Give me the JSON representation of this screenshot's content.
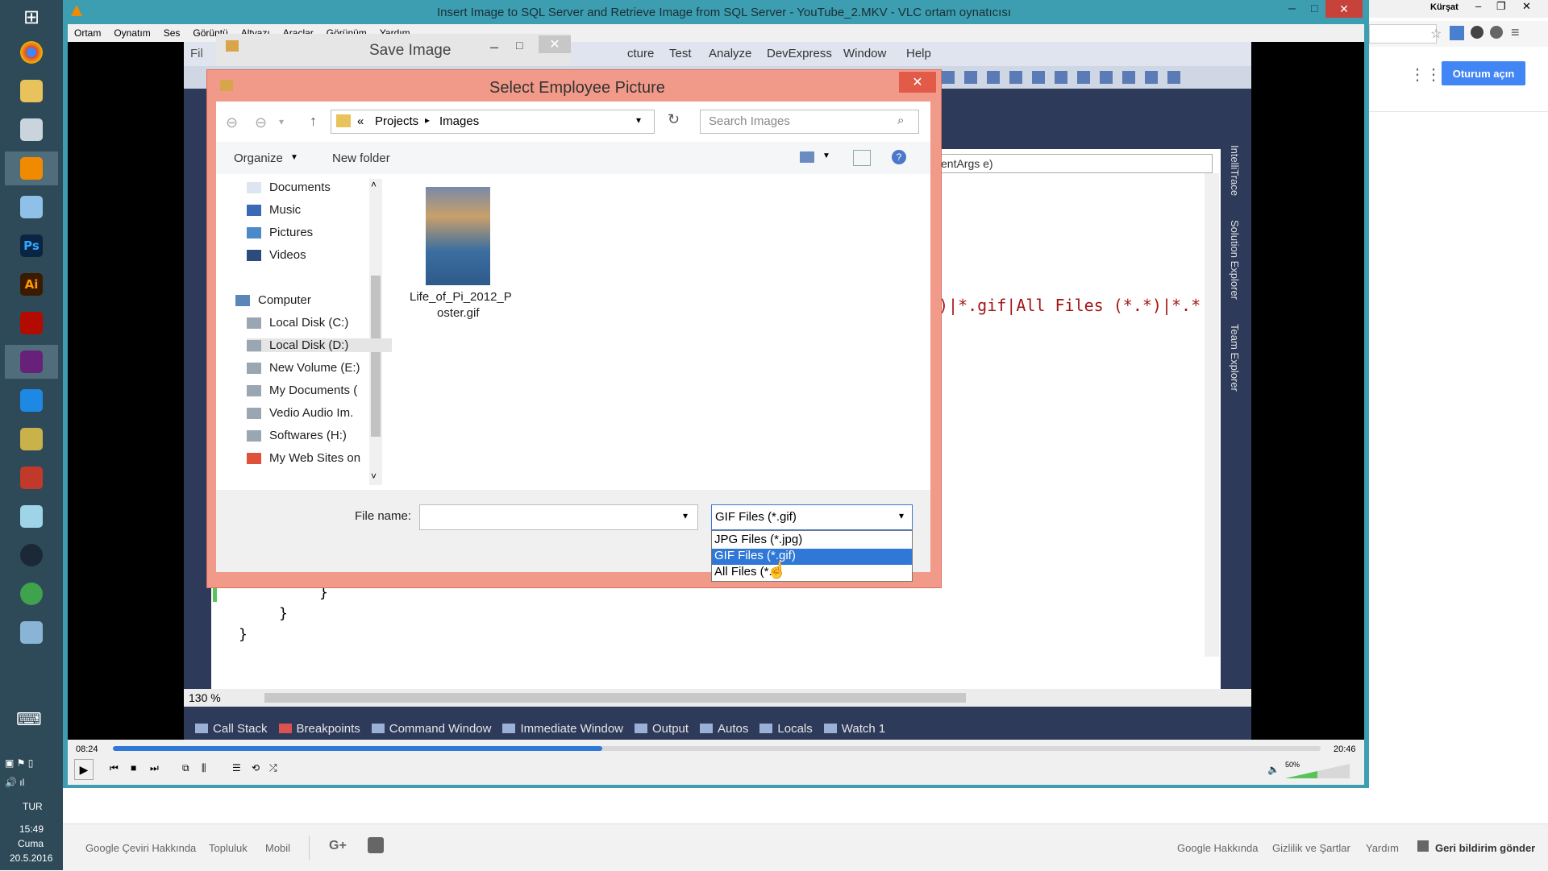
{
  "vlc": {
    "title": "Insert Image to SQL Server and Retrieve Image from SQL Server - YouTube_2.MKV - VLC ortam oynatıcısı",
    "menu": [
      "Ortam",
      "Oynatım",
      "Ses",
      "Görüntü",
      "Altyazı",
      "Araçlar",
      "Görünüm",
      "Yardım"
    ],
    "time_current": "08:24",
    "time_total": "20:46",
    "progress": 0.405,
    "volume": "50%"
  },
  "taskbar": {
    "icons": [
      "windows-start-icon",
      "chrome-icon",
      "file-explorer-icon",
      "snipping-tool-icon",
      "vlc-icon",
      "paint-icon",
      "photoshop-icon",
      "illustrator-icon",
      "acrobat-icon",
      "visual-studio-icon",
      "vscode-icon",
      "tools-icon",
      "access-icon",
      "notepad-icon",
      "steam-icon",
      "internet-download-icon",
      "calculator-icon"
    ],
    "lang": "TUR",
    "time": "15:49",
    "day": "Cuma",
    "date": "20.5.2016"
  },
  "vs": {
    "window_title": "Save Image",
    "menu": [
      "cture",
      "Test",
      "Analyze",
      "DevExpress",
      "Window",
      "Help"
    ],
    "code_hint": "entArgs e)",
    "code_line": ")|*.gif|All Files (*.*)|*.*",
    "zoom": "130 %",
    "bottom_tabs": [
      "Call Stack",
      "Breakpoints",
      "Command Window",
      "Immediate Window",
      "Output",
      "Autos",
      "Locals",
      "Watch 1"
    ],
    "side_tabs": [
      "IntelliTrace",
      "Solution Explorer",
      "Team Explorer"
    ]
  },
  "dialog": {
    "title": "Select Employee Picture",
    "breadcrumb": [
      "«",
      "Projects",
      "Images"
    ],
    "search_placeholder": "Search Images",
    "organize": "Organize",
    "new_folder": "New folder",
    "nav": [
      {
        "label": "Documents",
        "icon": "documents-icon",
        "color": "#dde6f0"
      },
      {
        "label": "Music",
        "icon": "music-icon",
        "color": "#3a6ab5"
      },
      {
        "label": "Pictures",
        "icon": "pictures-icon",
        "color": "#4b89c9"
      },
      {
        "label": "Videos",
        "icon": "videos-icon",
        "color": "#2d4c7e"
      },
      {
        "label": "Computer",
        "icon": "computer-icon",
        "color": "#5a87b8"
      },
      {
        "label": "Local Disk (C:)",
        "icon": "drive-icon",
        "color": "#9aa6b2"
      },
      {
        "label": "Local Disk (D:)",
        "icon": "drive-icon",
        "color": "#9aa6b2"
      },
      {
        "label": "New Volume (E:)",
        "icon": "drive-icon",
        "color": "#9aa6b2"
      },
      {
        "label": "My Documents (",
        "icon": "drive-icon",
        "color": "#9aa6b2"
      },
      {
        "label": "Vedio  Audio Im.",
        "icon": "drive-icon",
        "color": "#9aa6b2"
      },
      {
        "label": "Softwares (H:)",
        "icon": "drive-icon",
        "color": "#9aa6b2"
      },
      {
        "label": "My Web Sites on",
        "icon": "web-sites-icon",
        "color": "#e0513a"
      }
    ],
    "file": {
      "name_line1": "Life_of_Pi_2012_P",
      "name_line2": "oster.gif"
    },
    "file_name_label": "File name:",
    "file_name_value": "",
    "filter_selected": "GIF Files (*.gif)",
    "filter_options": [
      "JPG Files (*.jpg)",
      "GIF Files (*.gif)",
      "All Files (*.*)"
    ]
  },
  "browser": {
    "signin": "Oturum açın",
    "user": "Kürşat",
    "footer_left": [
      "Google Çeviri Hakkında",
      "Topluluk",
      "Mobil"
    ],
    "footer_right": [
      "Google Hakkında",
      "Gizlilik ve Şartlar",
      "Yardım",
      "Geri bildirim gönder"
    ],
    "accent": "#4285f4"
  }
}
